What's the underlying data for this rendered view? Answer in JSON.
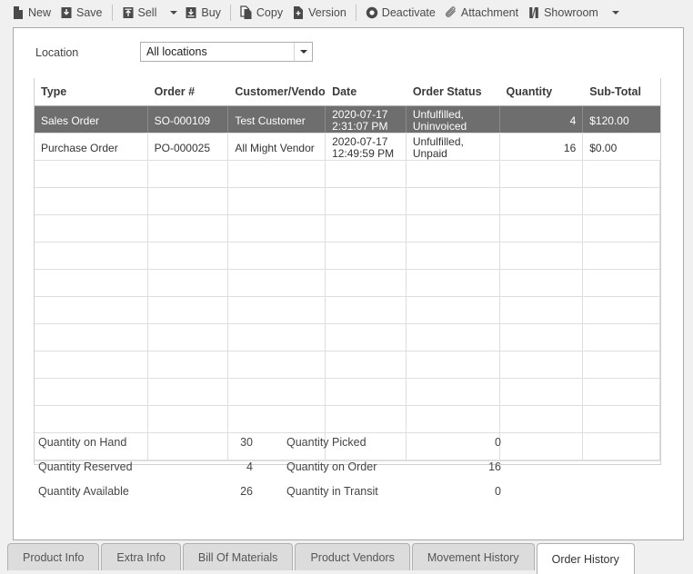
{
  "toolbar": {
    "items": [
      {
        "label": "New",
        "icon": "new-document-icon",
        "caret": false
      },
      {
        "label": "Save",
        "icon": "save-disk-icon",
        "caret": false
      },
      {
        "label": "Sell",
        "icon": "sell-arrow-up-icon",
        "caret": true
      },
      {
        "label": "Buy",
        "icon": "buy-arrow-down-icon",
        "caret": false
      },
      {
        "label": "Copy",
        "icon": "copy-pages-icon",
        "caret": false
      },
      {
        "label": "Version",
        "icon": "version-plus-document-icon",
        "caret": false
      },
      {
        "label": "Deactivate",
        "icon": "deactivate-circle-icon",
        "caret": false
      },
      {
        "label": "Attachment",
        "icon": "paperclip-icon",
        "caret": false
      },
      {
        "label": "Showroom",
        "icon": "showroom-icon",
        "caret": true
      }
    ]
  },
  "location": {
    "label": "Location",
    "selected": "All locations",
    "placeholder": "All locations",
    "dropdown_icon": "chevron-down-icon"
  },
  "grid": {
    "columns": [
      "Type",
      "Order #",
      "Customer/Vendor",
      "Date",
      "Order Status",
      "Quantity",
      "Sub-Total"
    ],
    "rows": [
      {
        "selected": true,
        "type": "Sales Order",
        "order_no": "SO-000109",
        "customer_vendor": "Test Customer",
        "date": "2020-07-17\n2:31:07 PM",
        "order_status": "Unfulfilled,\nUninvoiced",
        "quantity": "4",
        "sub_total": "$120.00"
      },
      {
        "selected": false,
        "type": "Purchase Order",
        "order_no": "PO-000025",
        "customer_vendor": "All Might Vendor",
        "date": "2020-07-17\n12:49:59 PM",
        "order_status": "Unfulfilled, Unpaid",
        "quantity": "16",
        "sub_total": "$0.00"
      }
    ],
    "empty_row_count": 11,
    "selection_color": "#6e6e6e"
  },
  "summary": {
    "rows": [
      {
        "left_label": "Quantity on Hand",
        "left_value": "30",
        "right_label": "Quantity Picked",
        "right_value": "0"
      },
      {
        "left_label": "Quantity Reserved",
        "left_value": "4",
        "right_label": "Quantity on Order",
        "right_value": "16"
      },
      {
        "left_label": "Quantity Available",
        "left_value": "26",
        "right_label": "Quantity in Transit",
        "right_value": "0"
      }
    ]
  },
  "tabs": {
    "items": [
      {
        "label": "Product Info",
        "active": false
      },
      {
        "label": "Extra Info",
        "active": false
      },
      {
        "label": "Bill Of Materials",
        "active": false
      },
      {
        "label": "Product Vendors",
        "active": false
      },
      {
        "label": "Movement History",
        "active": false
      },
      {
        "label": "Order History",
        "active": true
      }
    ]
  }
}
